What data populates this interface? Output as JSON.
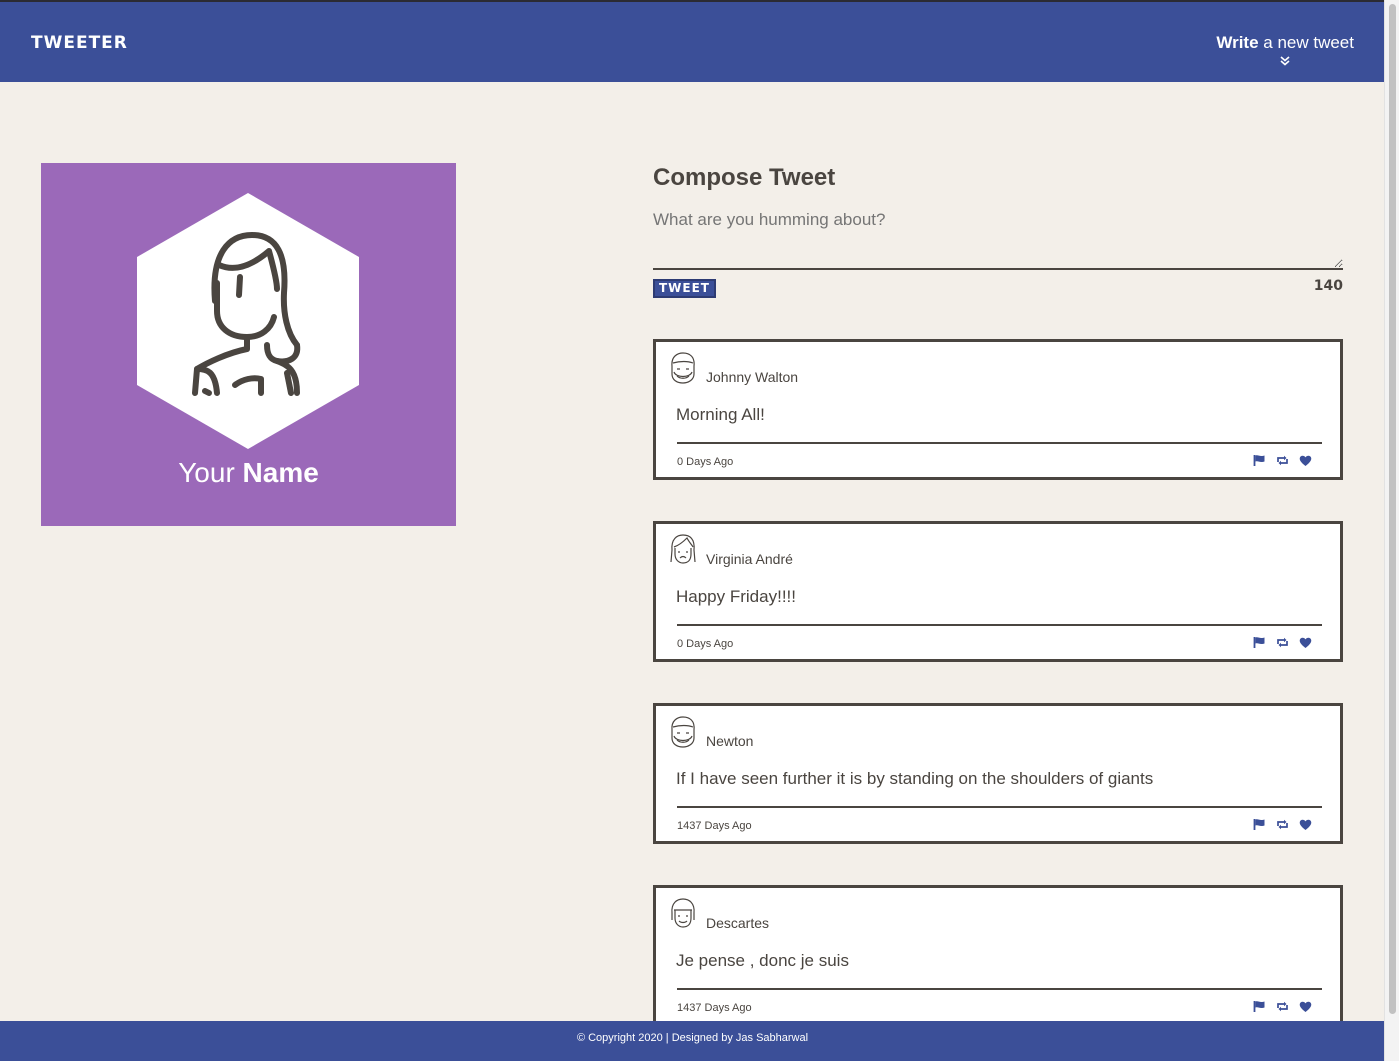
{
  "header": {
    "brand": "TWEETER",
    "write_bold": "Write",
    "write_rest": " a new tweet"
  },
  "profile": {
    "name_light": "Your ",
    "name_bold": "Name"
  },
  "compose": {
    "title": "Compose Tweet",
    "placeholder": "What are you humming about?",
    "button_label": "TWEET",
    "counter": "140"
  },
  "tweets": [
    {
      "name": "Johnny Walton",
      "text": "Morning All!",
      "age": "0 Days Ago"
    },
    {
      "name": "Virginia André",
      "text": "Happy Friday!!!!",
      "age": "0 Days Ago"
    },
    {
      "name": "Newton",
      "text": "If I have seen further it is by standing on the shoulders of giants",
      "age": "1437 Days Ago"
    },
    {
      "name": "Descartes",
      "text": "Je pense , donc je suis",
      "age": "1437 Days Ago"
    }
  ],
  "footer": {
    "text": "© Copyright 2020 | Designed by Jas Sabharwal"
  },
  "colors": {
    "navy": "#3b4f98",
    "purple": "#9b69b9",
    "background": "#f3efe9",
    "text": "#4a4540"
  }
}
